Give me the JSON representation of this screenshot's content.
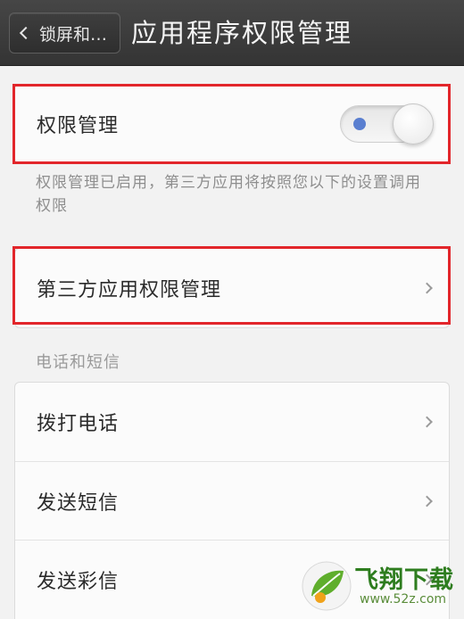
{
  "header": {
    "back_label": "锁屏和…",
    "title": "应用程序权限管理"
  },
  "permission_section": {
    "toggle_label": "权限管理",
    "toggle_state": "on",
    "description": "权限管理已启用，第三方应用将按照您以下的设置调用权限"
  },
  "third_party": {
    "label": "第三方应用权限管理"
  },
  "phone_sms": {
    "section_title": "电话和短信",
    "items": [
      {
        "label": "拨打电话"
      },
      {
        "label": "发送短信"
      },
      {
        "label": "发送彩信"
      }
    ]
  },
  "watermark": {
    "brand": "飞翔下载",
    "url": "www.52z.com"
  },
  "colors": {
    "highlight": "#e2262b",
    "toggle_dot": "#5a7fd0",
    "header_bg": "#3a3a3a"
  }
}
